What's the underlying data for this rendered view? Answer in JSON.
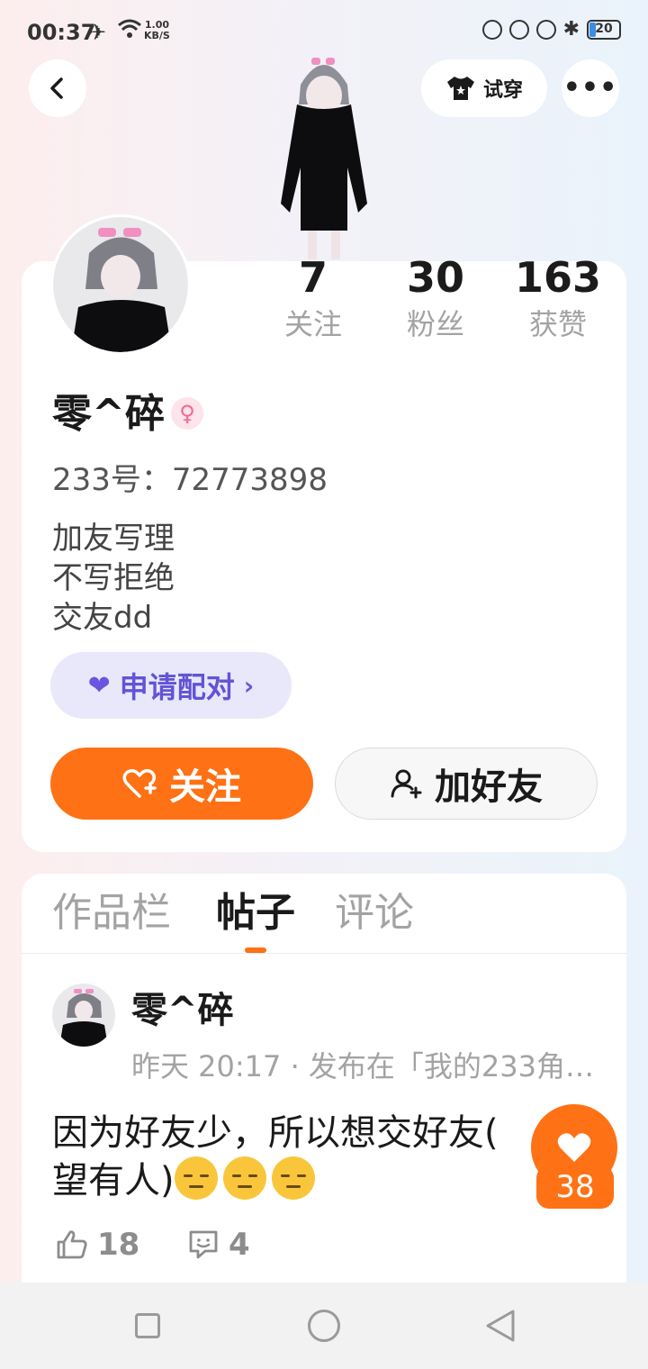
{
  "status_bar": {
    "time": "00:37",
    "speed_value": "1.00",
    "speed_unit": "KB/S",
    "battery": "20"
  },
  "header": {
    "try_on_label": "试穿"
  },
  "profile": {
    "stats": [
      {
        "value": "7",
        "label": "关注"
      },
      {
        "value": "30",
        "label": "粉丝"
      },
      {
        "value": "163",
        "label": "获赞"
      }
    ],
    "name": "零^碎",
    "gender_symbol": "♀",
    "id_line": "233号：72773898",
    "bio": [
      "加友写理",
      "不写拒绝",
      "交友dd"
    ],
    "pair_label": "申请配对",
    "follow_label": "关注",
    "add_friend_label": "加好友"
  },
  "tabs": [
    {
      "label": "作品栏",
      "active": false
    },
    {
      "label": "帖子",
      "active": true
    },
    {
      "label": "评论",
      "active": false
    }
  ],
  "post": {
    "author": "零^碎",
    "meta": "昨天 20:17 · 发布在「我的233角…",
    "text_line1": "因为好友少，所以想交好友(",
    "text_line2": "望有人)",
    "likes": "18",
    "comments": "4",
    "floating_like_count": "38"
  },
  "colors": {
    "accent_orange": "#fe7115",
    "pair_purple": "#6453d6",
    "muted_text": "#a3a3a3"
  }
}
